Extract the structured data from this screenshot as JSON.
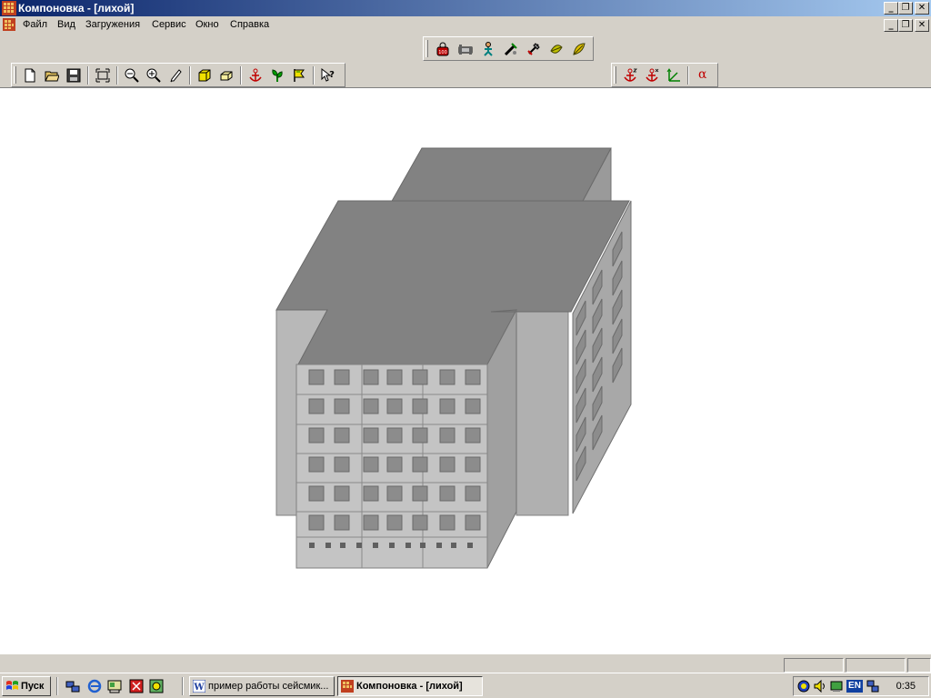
{
  "window": {
    "title": "Компоновка - [лихой]",
    "controls": {
      "minimize": "_",
      "restore": "❐",
      "close": "✕"
    }
  },
  "menu": {
    "items": [
      "Файл",
      "Вид",
      "Загружения",
      "Сервис",
      "Окно",
      "Справка"
    ]
  },
  "toolbar_right_top": {
    "icons": [
      "weight-icon",
      "bed-icon",
      "person-icon",
      "pipe-icon",
      "shovel-icon",
      "leaf-icon",
      "leaf-alt-icon"
    ]
  },
  "toolbar_main": {
    "icons": [
      "new-file-icon",
      "open-folder-icon",
      "save-icon",
      "fit-view-icon",
      "zoom-out-icon",
      "zoom-in-icon",
      "pencil-icon",
      "cube-icon",
      "cube-flat-icon",
      "anchor-icon",
      "plant-icon",
      "flag-icon",
      "help-cursor-icon"
    ]
  },
  "toolbar_coords": {
    "icons": [
      "anchor-z-icon",
      "anchor-x-icon",
      "axes-icon"
    ],
    "alpha_label": "α"
  },
  "taskbar": {
    "start_label": "Пуск",
    "tasks": [
      {
        "label": "пример работы сейсмик...",
        "active": false
      },
      {
        "label": "Компоновка - [лихой]",
        "active": true
      }
    ],
    "tray_lang": "EN",
    "clock": "0:35"
  },
  "colors": {
    "title_start": "#0a246a",
    "title_end": "#a6caf0",
    "model_roof": "#808080",
    "model_front": "#c0c0c0",
    "model_side": "#a0a0a0",
    "window_fill": "#8c8c8c"
  }
}
